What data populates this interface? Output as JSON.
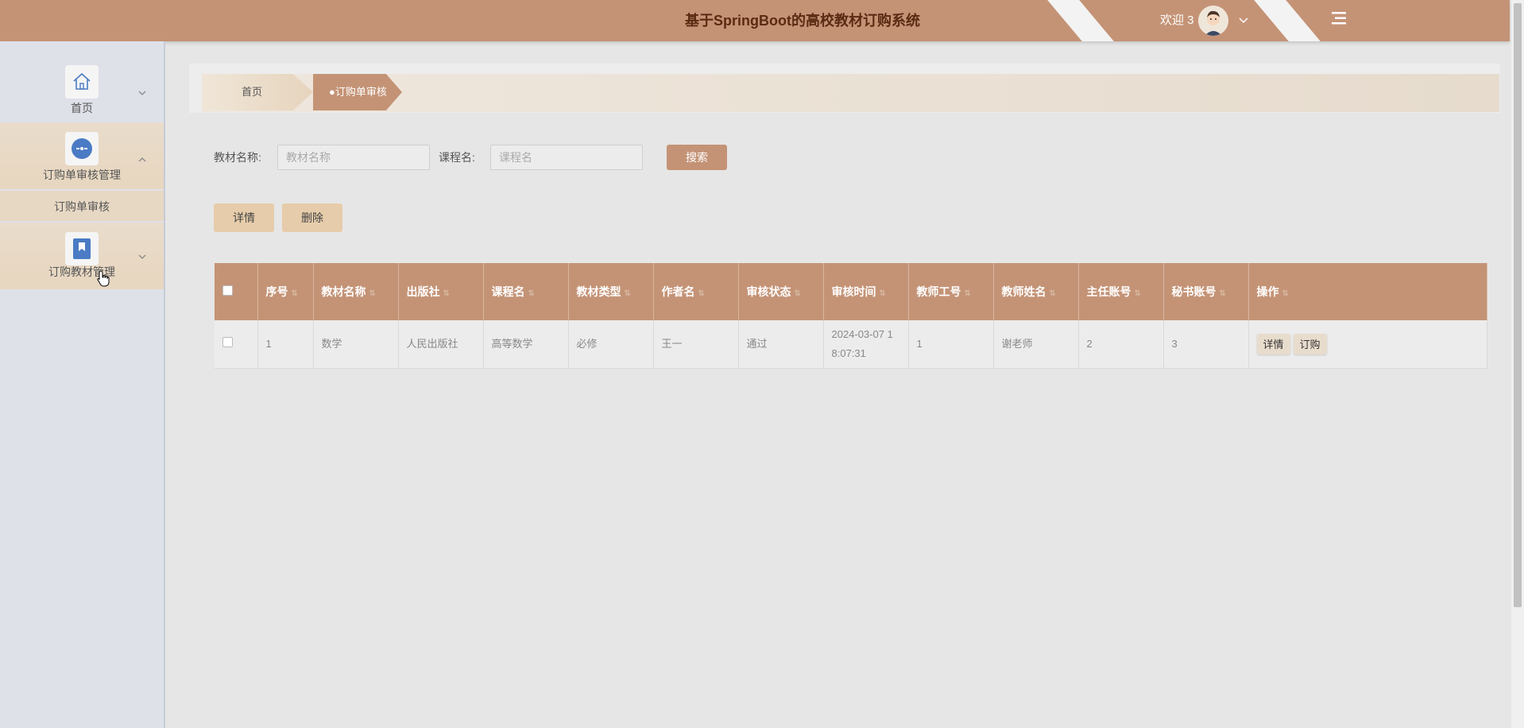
{
  "header": {
    "title": "基于SpringBoot的高校教材订购系统",
    "welcome": "欢迎 3"
  },
  "sidebar": {
    "items": [
      {
        "label": "首页",
        "icon": "home-icon"
      },
      {
        "label": "订购单审核管理",
        "icon": "dots-circle-icon",
        "children": [
          {
            "label": "订购单审核"
          }
        ]
      },
      {
        "label": "订购教材管理",
        "icon": "bookmark-icon"
      }
    ]
  },
  "breadcrumb": {
    "home": "首页",
    "current": "●订购单审核"
  },
  "search": {
    "textbook_label": "教材名称:",
    "textbook_placeholder": "教材名称",
    "course_label": "课程名:",
    "course_placeholder": "课程名",
    "search_button": "搜索"
  },
  "actions": {
    "detail": "详情",
    "delete": "删除"
  },
  "table": {
    "columns": [
      "序号",
      "教材名称",
      "出版社",
      "课程名",
      "教材类型",
      "作者名",
      "审核状态",
      "审核时间",
      "教师工号",
      "教师姓名",
      "主任账号",
      "秘书账号",
      "操作"
    ],
    "rows": [
      {
        "index": "1",
        "textbook": "数学",
        "publisher": "人民出版社",
        "course": "高等数学",
        "type": "必修",
        "author": "王一",
        "status": "通过",
        "time": "2024-03-07 18:07:31",
        "teacher_id": "1",
        "teacher_name": "谢老师",
        "director": "2",
        "secretary": "3",
        "op_detail": "详情",
        "op_order": "订购"
      }
    ]
  },
  "colors": {
    "primary": "#c49376",
    "title_text": "#5a2a12",
    "sidebar_bg": "#dfe1e9",
    "light_button": "#e6ccaa"
  }
}
